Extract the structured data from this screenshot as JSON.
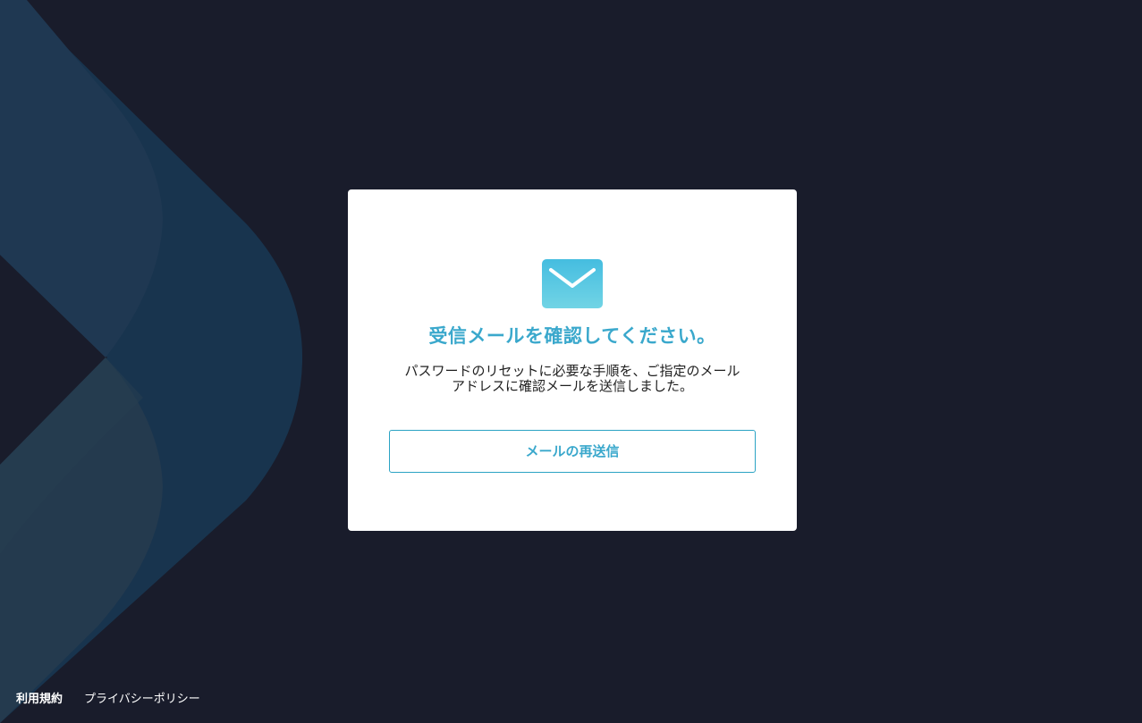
{
  "card": {
    "icon": "mail-icon",
    "title": "受信メールを確認してください。",
    "message_line1": "パスワードのリセットに必要な手順を、ご指定のメール",
    "message_line2": "アドレスに確認メールを送信しました。",
    "resend_label": "メールの再送信"
  },
  "footer": {
    "terms_label": "利用規約",
    "privacy_label": "プライバシーポリシー"
  },
  "colors": {
    "background": "#191c2b",
    "accent": "#3aa8cc",
    "icon_top": "#46bfe0",
    "icon_bottom": "#6fd3e6"
  }
}
